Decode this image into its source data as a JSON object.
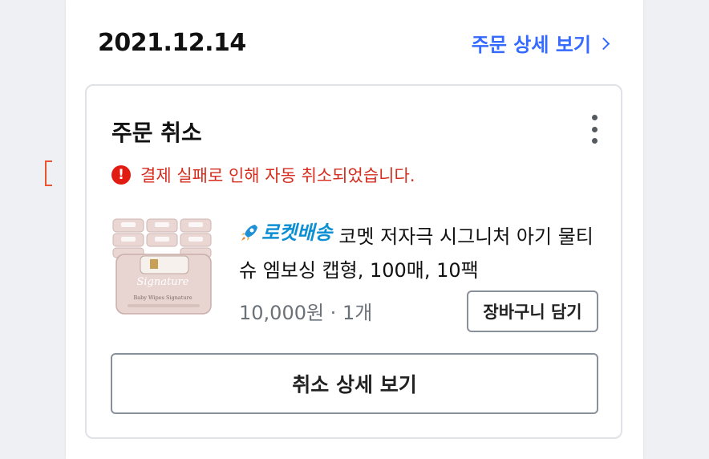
{
  "order": {
    "date": "2021.12.14",
    "detail_link_label": "주문 상세 보기"
  },
  "status": {
    "title": "주문 취소",
    "alert_icon": "!",
    "alert_message": "결제 실패로 인해 자동 취소되었습니다."
  },
  "product": {
    "badge_label": "로켓배송",
    "name": "코멧 저자극 시그니처 아기 물티슈 엠보싱 캡형, 100매, 10팩",
    "price_qty": "10,000원 · 1개",
    "thumb_caption": "Baby Wipes Signature"
  },
  "actions": {
    "add_to_cart_label": "장바구니 담기",
    "cancel_detail_label": "취소 상세 보기"
  },
  "colors": {
    "accent": "#346aff",
    "alert": "#d62d1f",
    "rocket": "#0d8fd4"
  },
  "icons": {
    "detail_link": "chevron-right-icon",
    "more": "kebab-menu-icon",
    "alert": "error-icon",
    "badge": "rocket-icon"
  }
}
